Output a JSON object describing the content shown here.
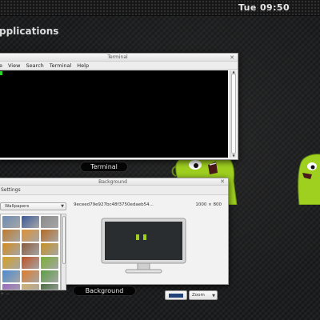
{
  "top_bar": {
    "clock": "Tue 09:50"
  },
  "overview": {
    "title": "pplications"
  },
  "terminal_window": {
    "title": "Terminal",
    "menus": [
      "e",
      "View",
      "Search",
      "Terminal",
      "Help"
    ],
    "caption": "Terminal",
    "cursor_color": "#29d429"
  },
  "background_window": {
    "title": "Background",
    "toolbar_label": "Settings",
    "category": "Wallpapers",
    "wallpaper_name": "9eceed79e927bc48f3750edaeb54...",
    "resolution": "1000 × 800",
    "color_swatch": "#22427a",
    "zoom": "Zoom",
    "caption": "Background",
    "thumbnails": [
      "#6b8bb5",
      "#3a5a9a",
      "#8a8a8a",
      "#c07a2a",
      "#e09030",
      "#b86a20",
      "#d48a1a",
      "#8a5a3a",
      "#c89020",
      "#d8a020",
      "#c05020",
      "#7ab030",
      "#4a8ad0",
      "#e07a28",
      "#5aa040",
      "#9a6ac0",
      "#d0b070",
      "#4a7040"
    ]
  },
  "colors": {
    "desktop_bg": "#1d1e1f",
    "mascot_green": "#9fd020"
  }
}
